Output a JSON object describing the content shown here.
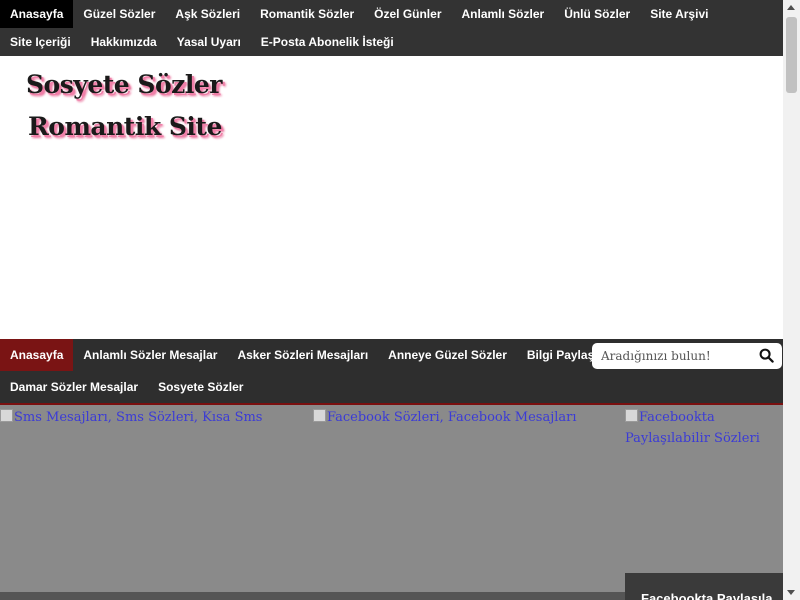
{
  "top_nav": {
    "items": [
      {
        "label": "Anasayfa",
        "active": true
      },
      {
        "label": "Güzel Sözler"
      },
      {
        "label": "Aşk Sözleri"
      },
      {
        "label": "Romantik Sözler"
      },
      {
        "label": "Özel Günler"
      },
      {
        "label": "Anlamlı Sözler"
      },
      {
        "label": "Ünlü Sözler"
      },
      {
        "label": "Site Arşivi"
      },
      {
        "label": "Site Içeriği"
      },
      {
        "label": "Hakkımızda"
      },
      {
        "label": "Yasal Uyarı"
      },
      {
        "label": "E-Posta Abonelik İsteği"
      }
    ]
  },
  "header": {
    "logo_line1": "Sosyete Sözler",
    "logo_line2": "Romantik Site"
  },
  "main_nav": {
    "items": [
      {
        "label": "Anasayfa",
        "active": true
      },
      {
        "label": "Anlamlı Sözler Mesajlar"
      },
      {
        "label": "Asker Sözleri Mesajları"
      },
      {
        "label": "Anneye Güzel Sözler"
      },
      {
        "label": "Bilgi Paylaşım"
      },
      {
        "label": "Damar Sözler Mesajlar"
      },
      {
        "label": "Sosyete Sözler"
      }
    ]
  },
  "search": {
    "placeholder": "Aradığınızı bulun!"
  },
  "slider": {
    "slides": [
      {
        "alt": "Sms Mesajları, Sms Sözleri, Kısa Sms"
      },
      {
        "alt": "Facebook Sözleri, Facebook Mesajları"
      },
      {
        "alt": "Facebookta Paylaşılabilir Sözleri"
      }
    ],
    "caption": "Facebookta Paylaşıla"
  },
  "colors": {
    "nav_bg": "#333333",
    "active_top": "#000000",
    "active_main": "#7a1414",
    "slider_bg": "#8a8a8a",
    "link": "#3b3bd6"
  }
}
